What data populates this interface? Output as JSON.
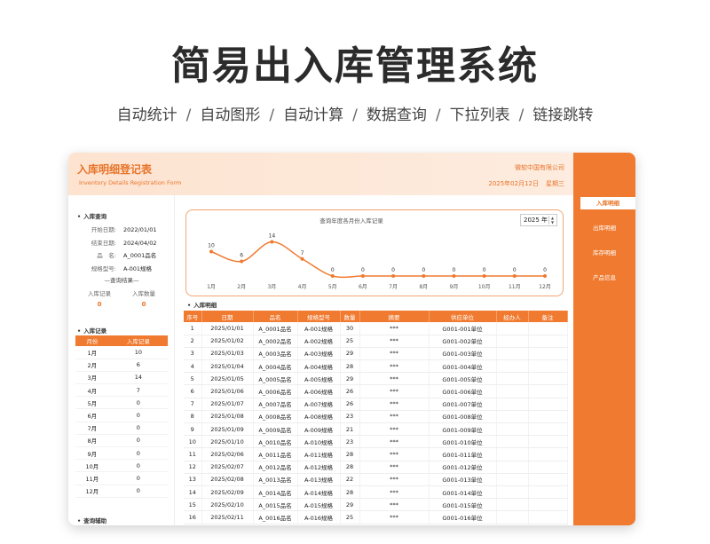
{
  "hero": {
    "title": "简易出入库管理系统",
    "features": [
      "自动统计",
      "自动图形",
      "自动计算",
      "数据查询",
      "下拉列表",
      "链接跳转"
    ],
    "separator": "/"
  },
  "header": {
    "title": "入库明细登记表",
    "subtitle": "Inventory Details Registration Form",
    "company": "微软中国有限公司",
    "date": "2025年02月12日",
    "weekday": "星期三"
  },
  "nav": {
    "items": [
      {
        "label": "入库明细",
        "active": true
      },
      {
        "label": "出库明细",
        "active": false
      },
      {
        "label": "库存明细",
        "active": false
      },
      {
        "label": "产品信息",
        "active": false
      }
    ]
  },
  "query": {
    "title": "入库查询",
    "fields": [
      {
        "label": "开始日期:",
        "value": "2022/01/01"
      },
      {
        "label": "结束日期:",
        "value": "2024/04/02"
      },
      {
        "label": "品　名:",
        "value": "A_0001品名"
      },
      {
        "label": "规格型号:",
        "value": "A-001规格"
      }
    ],
    "result_title": "—查询结果—",
    "stats": [
      {
        "label": "入库记录",
        "value": "0"
      },
      {
        "label": "入库数量",
        "value": "0"
      }
    ]
  },
  "records": {
    "title": "入库记录",
    "headers": [
      "月份",
      "入库记录"
    ],
    "rows": [
      [
        "1月",
        "10"
      ],
      [
        "2月",
        "6"
      ],
      [
        "3月",
        "14"
      ],
      [
        "4月",
        "7"
      ],
      [
        "5月",
        "0"
      ],
      [
        "6月",
        "0"
      ],
      [
        "7月",
        "0"
      ],
      [
        "8月",
        "0"
      ],
      [
        "9月",
        "0"
      ],
      [
        "10月",
        "0"
      ],
      [
        "11月",
        "0"
      ],
      [
        "12月",
        "0"
      ]
    ]
  },
  "aux": {
    "title": "查询辅助"
  },
  "chart_data": {
    "type": "line",
    "title": "查询年度各月份入库记录",
    "year_label": "2025 年",
    "categories": [
      "1月",
      "2月",
      "3月",
      "4月",
      "5月",
      "6月",
      "7月",
      "8月",
      "9月",
      "10月",
      "11月",
      "12月"
    ],
    "values": [
      10,
      6,
      14,
      7,
      0,
      0,
      0,
      0,
      0,
      0,
      0,
      0
    ],
    "ylim": [
      0,
      16
    ],
    "grid": false,
    "color": "#f07a2f"
  },
  "detail": {
    "title": "入库明细",
    "headers": [
      "序号",
      "日期",
      "品名",
      "规格型号",
      "数量",
      "摘要",
      "供应单位",
      "经办人",
      "备注"
    ],
    "rows": [
      [
        "1",
        "2025/01/01",
        "A_0001品名",
        "A-001规格",
        "30",
        "***",
        "G001-001单位",
        "",
        ""
      ],
      [
        "2",
        "2025/01/02",
        "A_0002品名",
        "A-002规格",
        "25",
        "***",
        "G001-002单位",
        "",
        ""
      ],
      [
        "3",
        "2025/01/03",
        "A_0003品名",
        "A-003规格",
        "29",
        "***",
        "G001-003单位",
        "",
        ""
      ],
      [
        "4",
        "2025/01/04",
        "A_0004品名",
        "A-004规格",
        "28",
        "***",
        "G001-004单位",
        "",
        ""
      ],
      [
        "5",
        "2025/01/05",
        "A_0005品名",
        "A-005规格",
        "29",
        "***",
        "G001-005单位",
        "",
        ""
      ],
      [
        "6",
        "2025/01/06",
        "A_0006品名",
        "A-006规格",
        "26",
        "***",
        "G001-006单位",
        "",
        ""
      ],
      [
        "7",
        "2025/01/07",
        "A_0007品名",
        "A-007规格",
        "26",
        "***",
        "G001-007单位",
        "",
        ""
      ],
      [
        "8",
        "2025/01/08",
        "A_0008品名",
        "A-008规格",
        "23",
        "***",
        "G001-008单位",
        "",
        ""
      ],
      [
        "9",
        "2025/01/09",
        "A_0009品名",
        "A-009规格",
        "21",
        "***",
        "G001-009单位",
        "",
        ""
      ],
      [
        "10",
        "2025/01/10",
        "A_0010品名",
        "A-010规格",
        "23",
        "***",
        "G001-010单位",
        "",
        ""
      ],
      [
        "11",
        "2025/02/06",
        "A_0011品名",
        "A-011规格",
        "28",
        "***",
        "G001-011单位",
        "",
        ""
      ],
      [
        "12",
        "2025/02/07",
        "A_0012品名",
        "A-012规格",
        "28",
        "***",
        "G001-012单位",
        "",
        ""
      ],
      [
        "13",
        "2025/02/08",
        "A_0013品名",
        "A-013规格",
        "22",
        "***",
        "G001-013单位",
        "",
        ""
      ],
      [
        "14",
        "2025/02/09",
        "A_0014品名",
        "A-014规格",
        "28",
        "***",
        "G001-014单位",
        "",
        ""
      ],
      [
        "15",
        "2025/02/10",
        "A_0015品名",
        "A-015规格",
        "29",
        "***",
        "G001-015单位",
        "",
        ""
      ],
      [
        "16",
        "2025/02/11",
        "A_0016品名",
        "A-016规格",
        "25",
        "***",
        "G001-016单位",
        "",
        ""
      ]
    ]
  },
  "colors": {
    "accent": "#f07a2f",
    "header_bg": "#fde3d0"
  }
}
